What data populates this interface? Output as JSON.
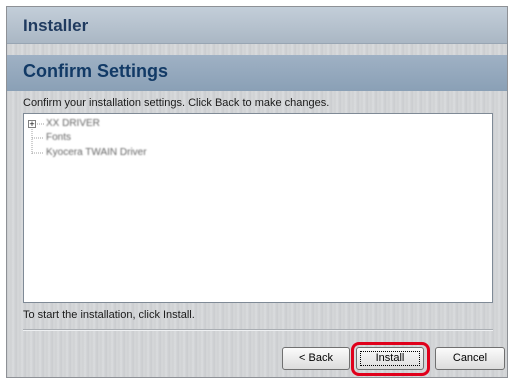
{
  "window": {
    "title": "Installer"
  },
  "header": {
    "title": "Confirm Settings"
  },
  "main": {
    "instruction": "Confirm your installation settings. Click Back to make changes.",
    "tree": {
      "items": [
        {
          "label": "XX DRIVER",
          "expanded": false,
          "has_children": true
        },
        {
          "label": "Fonts",
          "has_children": false
        },
        {
          "label": "Kyocera TWAIN Driver",
          "has_children": false
        }
      ]
    },
    "footer_text": "To start the installation, click Install."
  },
  "buttons": {
    "back": "< Back",
    "install": "Install",
    "cancel": "Cancel"
  },
  "highlight": {
    "target": "install-button",
    "color": "#e0001b"
  }
}
